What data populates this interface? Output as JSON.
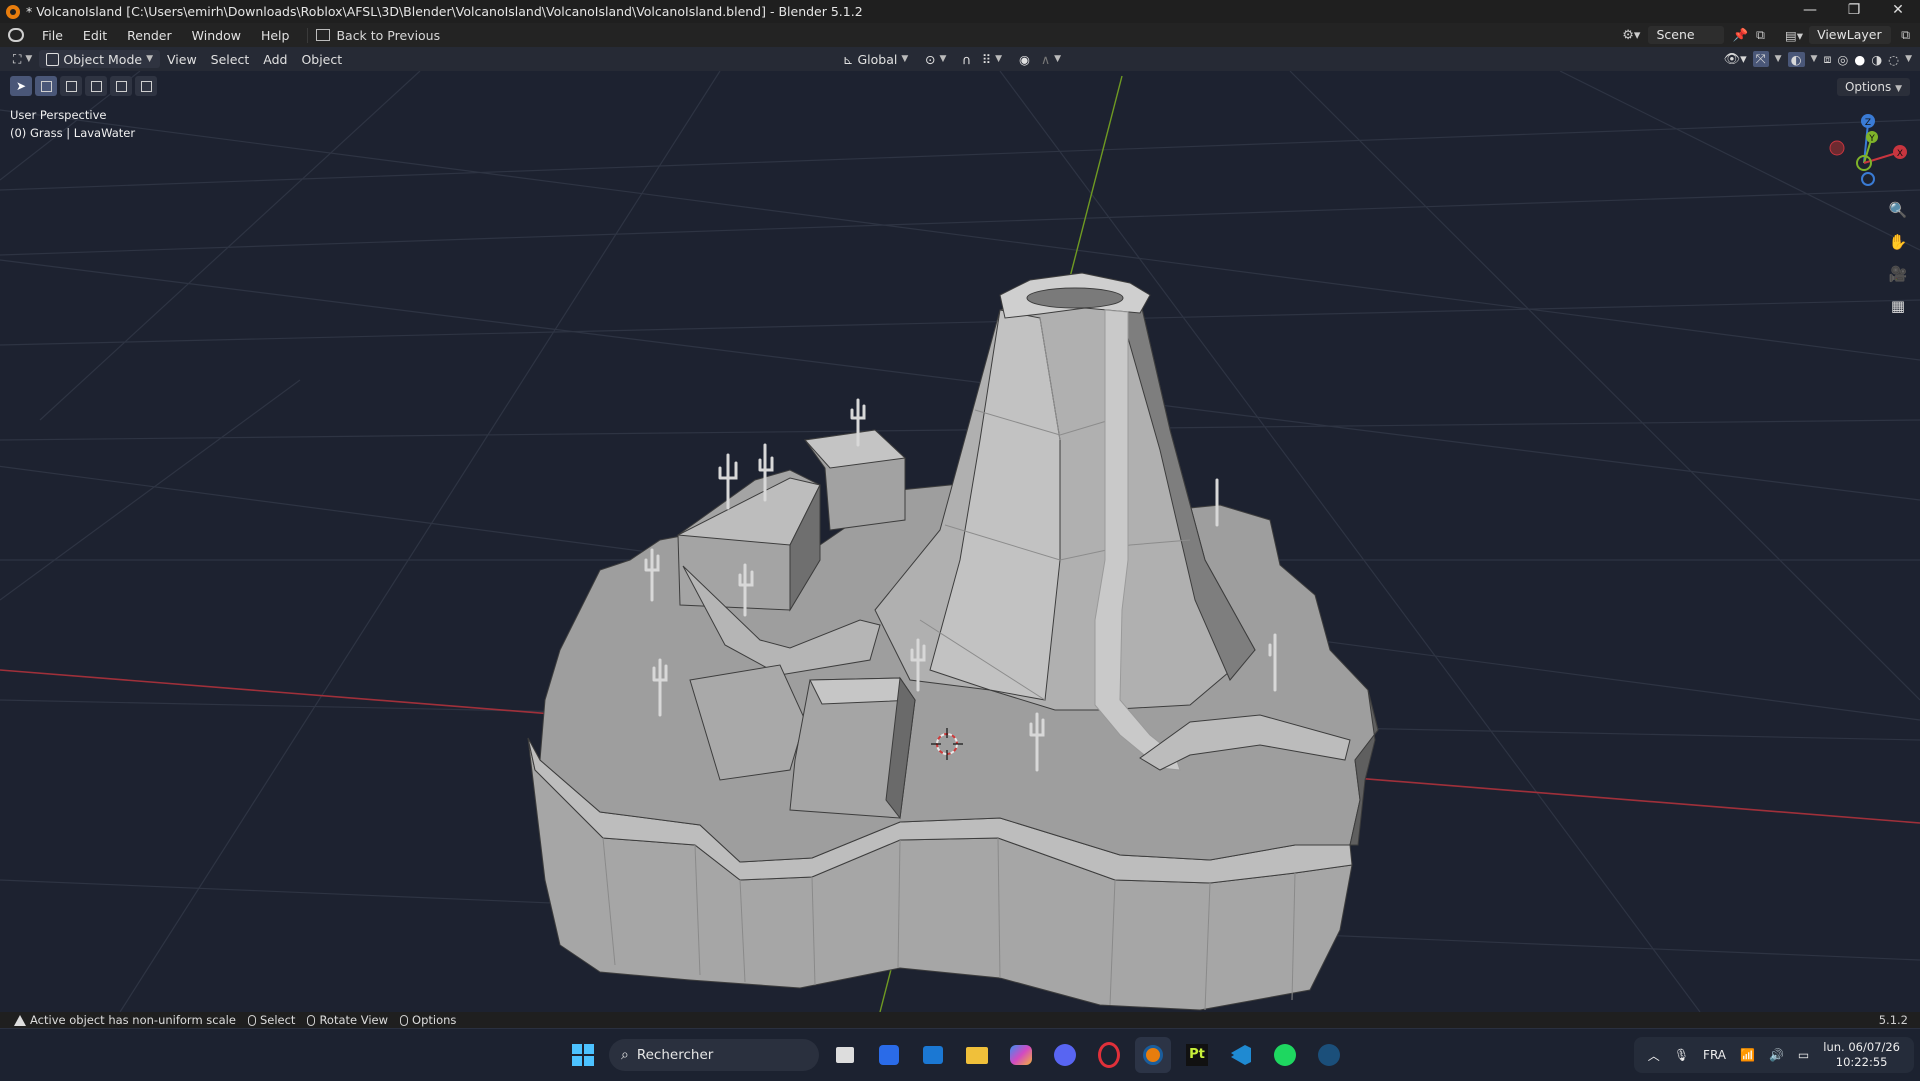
{
  "window": {
    "title": "* VolcanoIsland [C:\\Users\\emirh\\Downloads\\Roblox\\AFSL\\3D\\Blender\\VolcanoIsland\\VolcanoIsland\\VolcanoIsland.blend] - Blender 5.1.2",
    "minimize": "—",
    "restore": "❐",
    "close": "✕"
  },
  "menubar": {
    "items": [
      "File",
      "Edit",
      "Render",
      "Window",
      "Help"
    ],
    "back_label": "Back to Previous",
    "scene_label": "Scene",
    "viewlayer_label": "ViewLayer"
  },
  "header": {
    "mode": "Object Mode",
    "menus": [
      "View",
      "Select",
      "Add",
      "Object"
    ],
    "orientation": "Global"
  },
  "viewport": {
    "perspective": "User Perspective",
    "collection_info": "(0) Grass | LavaWater",
    "options_label": "Options",
    "gizmo": {
      "z": "Z",
      "y": "Y",
      "x": "X"
    },
    "colors": {
      "x_axis": "#c8353f",
      "y_axis": "#7fb32a",
      "z_axis": "#3a7bd5",
      "grid": "#2d3340",
      "background": "#1d2230"
    }
  },
  "statusbar": {
    "warning": "Active object has non-uniform scale",
    "select": "Select",
    "rotate": "Rotate View",
    "options": "Options",
    "version": "5.1.2"
  },
  "taskbar": {
    "search_placeholder": "Rechercher",
    "apps": [
      "windows-start",
      "task-view",
      "roblox-studio",
      "outlook",
      "file-explorer",
      "copilot",
      "discord",
      "opera-gx",
      "blender",
      "pycharm",
      "vscode",
      "spotify",
      "steam"
    ],
    "language": "FRA",
    "date": "lun. 06/07/26",
    "time": "10:22:55"
  }
}
